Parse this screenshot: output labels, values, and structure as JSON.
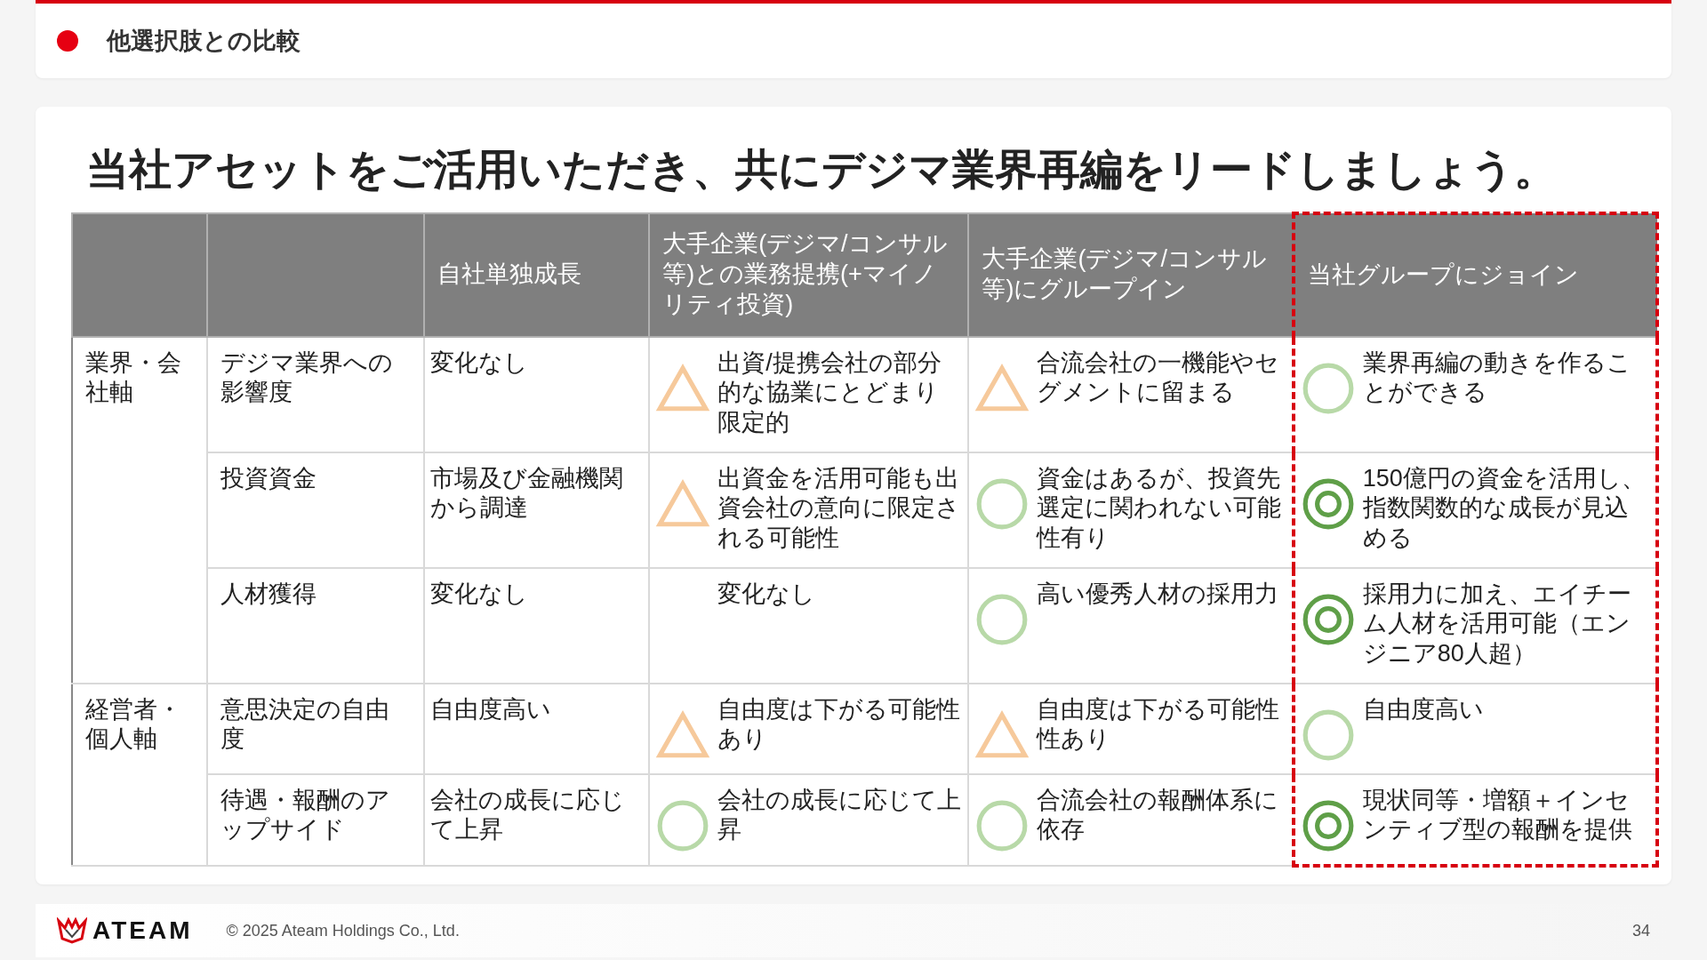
{
  "header": {
    "title": "他選択肢との比較"
  },
  "main": {
    "heading": "当社アセットをご活用いただき、共にデジマ業界再編をリードしましょう。",
    "table": {
      "columns": [
        {
          "label": "自社単独成長",
          "highlighted": false
        },
        {
          "label": "大手企業(デジマ/コンサル等)との業務提携(+マイノリティ投資)",
          "highlighted": false
        },
        {
          "label": "大手企業(デジマ/コンサル等)にグループイン",
          "highlighted": false
        },
        {
          "label": "当社グループにジョイン",
          "highlighted": true
        }
      ],
      "groups": [
        {
          "label": "業界・会社軸",
          "rows": [
            {
              "item": "デジマ業界への影響度",
              "cells": [
                {
                  "kind": "none",
                  "text": "変化なし"
                },
                {
                  "kind": "triangle",
                  "text": "出資/提携会社の部分的な協業にとどまり限定的"
                },
                {
                  "kind": "triangle",
                  "text": "合流会社の一機能やセグメントに留まる"
                },
                {
                  "kind": "circle",
                  "text": "業界再編の動きを作ることができる"
                }
              ]
            },
            {
              "item": "投資資金",
              "cells": [
                {
                  "kind": "none",
                  "text": "市場及び金融機関から調達"
                },
                {
                  "kind": "triangle",
                  "text": "出資金を活用可能も出資会社の意向に限定される可能性"
                },
                {
                  "kind": "circle",
                  "text": "資金はあるが、投資先選定に関われない可能性有り"
                },
                {
                  "kind": "double-circle",
                  "text": "150億円の資金を活用し、指数関数的な成長が見込める"
                }
              ]
            },
            {
              "item": "人材獲得",
              "cells": [
                {
                  "kind": "none",
                  "text": "変化なし"
                },
                {
                  "kind": "blank",
                  "text": "変化なし"
                },
                {
                  "kind": "circle",
                  "text": "高い優秀人材の採用力"
                },
                {
                  "kind": "double-circle",
                  "text": "採用力に加え、エイチーム人材を活用可能（エンジニア80人超）"
                }
              ]
            }
          ]
        },
        {
          "label": "経営者・個人軸",
          "rows": [
            {
              "item": "意思決定の自由度",
              "cells": [
                {
                  "kind": "none",
                  "text": "自由度高い"
                },
                {
                  "kind": "triangle",
                  "text": "自由度は下がる可能性あり"
                },
                {
                  "kind": "triangle",
                  "text": "自由度は下がる可能性性あり"
                },
                {
                  "kind": "circle",
                  "text": "自由度高い"
                }
              ]
            },
            {
              "item": "待遇・報酬のアップサイド",
              "cells": [
                {
                  "kind": "none",
                  "text": "会社の成長に応じて上昇"
                },
                {
                  "kind": "circle",
                  "text": "会社の成長に応じて上昇"
                },
                {
                  "kind": "circle",
                  "text": "合流会社の報酬体系に依存"
                },
                {
                  "kind": "double-circle",
                  "text": "現状同等・増額＋インセンティブ型の報酬を提供"
                }
              ]
            }
          ]
        }
      ]
    }
  },
  "footer": {
    "logo": "ATEAM",
    "copyright": "© 2025 Ateam Holdings Co., Ltd.",
    "page": "34"
  }
}
